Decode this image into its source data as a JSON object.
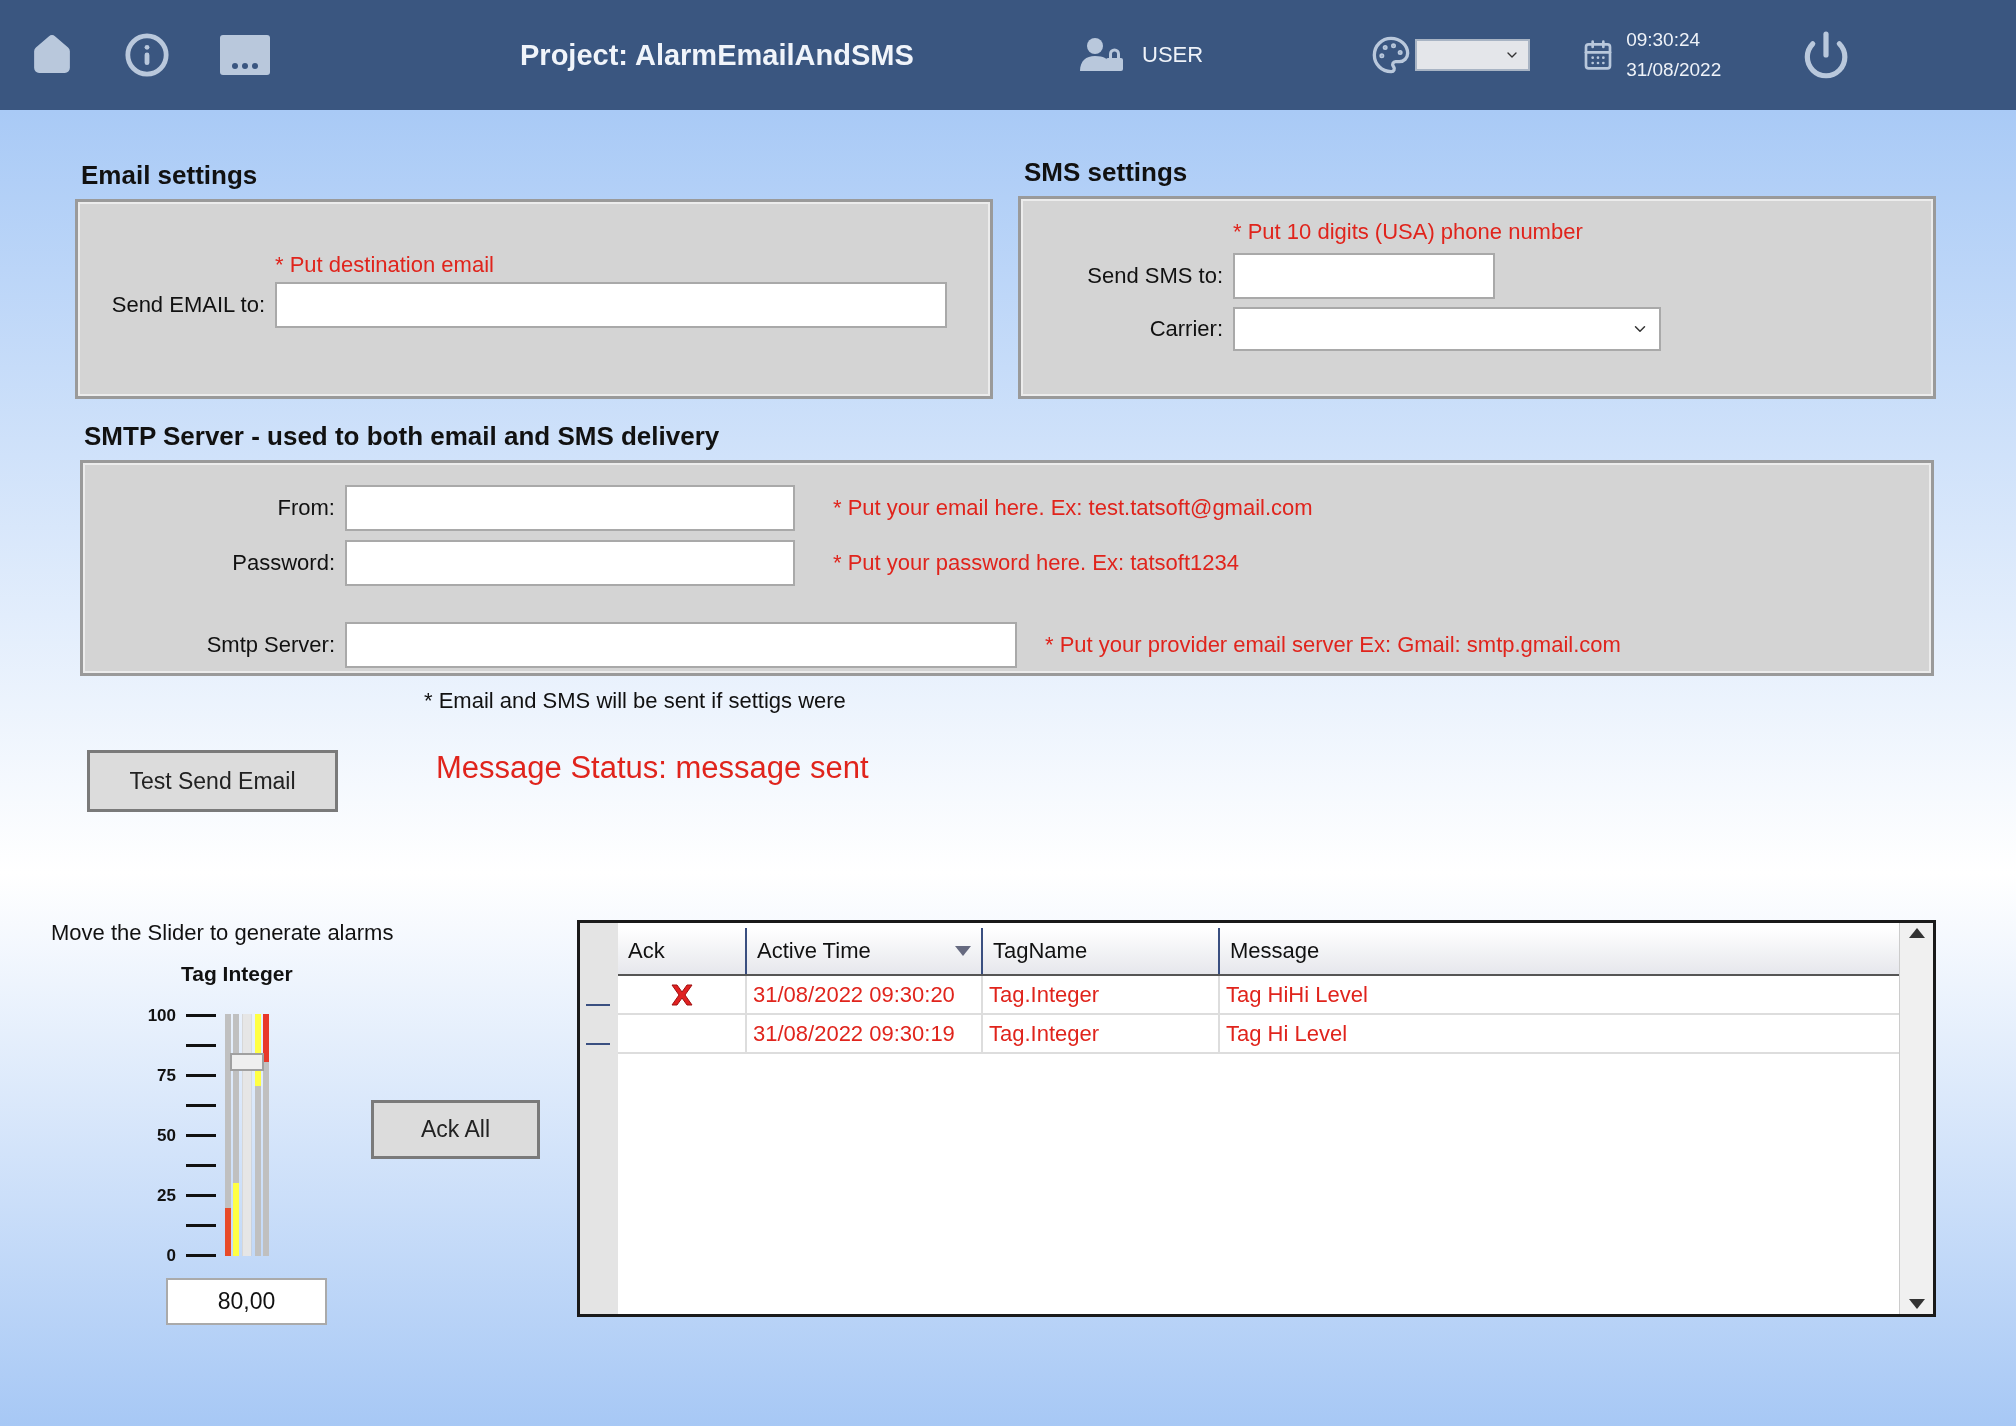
{
  "header": {
    "title": "Project: AlarmEmailAndSMS",
    "user": "USER",
    "time": "09:30:24",
    "date": "31/08/2022"
  },
  "email": {
    "title": "Email settings",
    "hint": "* Put destination email",
    "label": "Send EMAIL to:"
  },
  "sms": {
    "title": "SMS settings",
    "hint": "* Put 10 digits (USA) phone number",
    "label": "Send SMS to:",
    "carrier_label": "Carrier:"
  },
  "smtp": {
    "title": "SMTP Server - used to both email and SMS delivery",
    "fields": [
      {
        "label": "From:",
        "hint": "* Put your email here. Ex: test.tatsoft@gmail.com"
      },
      {
        "label": "Password:",
        "hint": "* Put your password here. Ex: tatsoft1234"
      },
      {
        "label": "Smtp Server:",
        "hint": "* Put your provider email server Ex: Gmail: smtp.gmail.com"
      }
    ]
  },
  "note": "* Email and SMS will be sent if settigs were",
  "test_button": "Test Send Email",
  "message_status": "Message Status: message sent",
  "slider": {
    "caption": "Move the Slider to generate alarms",
    "title": "Tag Integer",
    "ticks": [
      "100",
      "75",
      "50",
      "25",
      "0"
    ],
    "level": 0.8,
    "value": "80,00"
  },
  "ack_all": "Ack All",
  "alarms": {
    "columns": [
      {
        "label": "Ack",
        "sorted": false
      },
      {
        "label": "Active Time",
        "sorted": true
      },
      {
        "label": "TagName",
        "sorted": false
      },
      {
        "label": "Message",
        "sorted": false
      }
    ],
    "rows": [
      {
        "unacknowledged": true,
        "cells": [
          "",
          "31/08/2022 09:30:20",
          "Tag.Integer",
          "Tag HiHi Level"
        ]
      },
      {
        "unacknowledged": false,
        "cells": [
          "",
          "31/08/2022 09:30:19",
          "Tag.Integer",
          "Tag Hi Level"
        ]
      }
    ]
  }
}
